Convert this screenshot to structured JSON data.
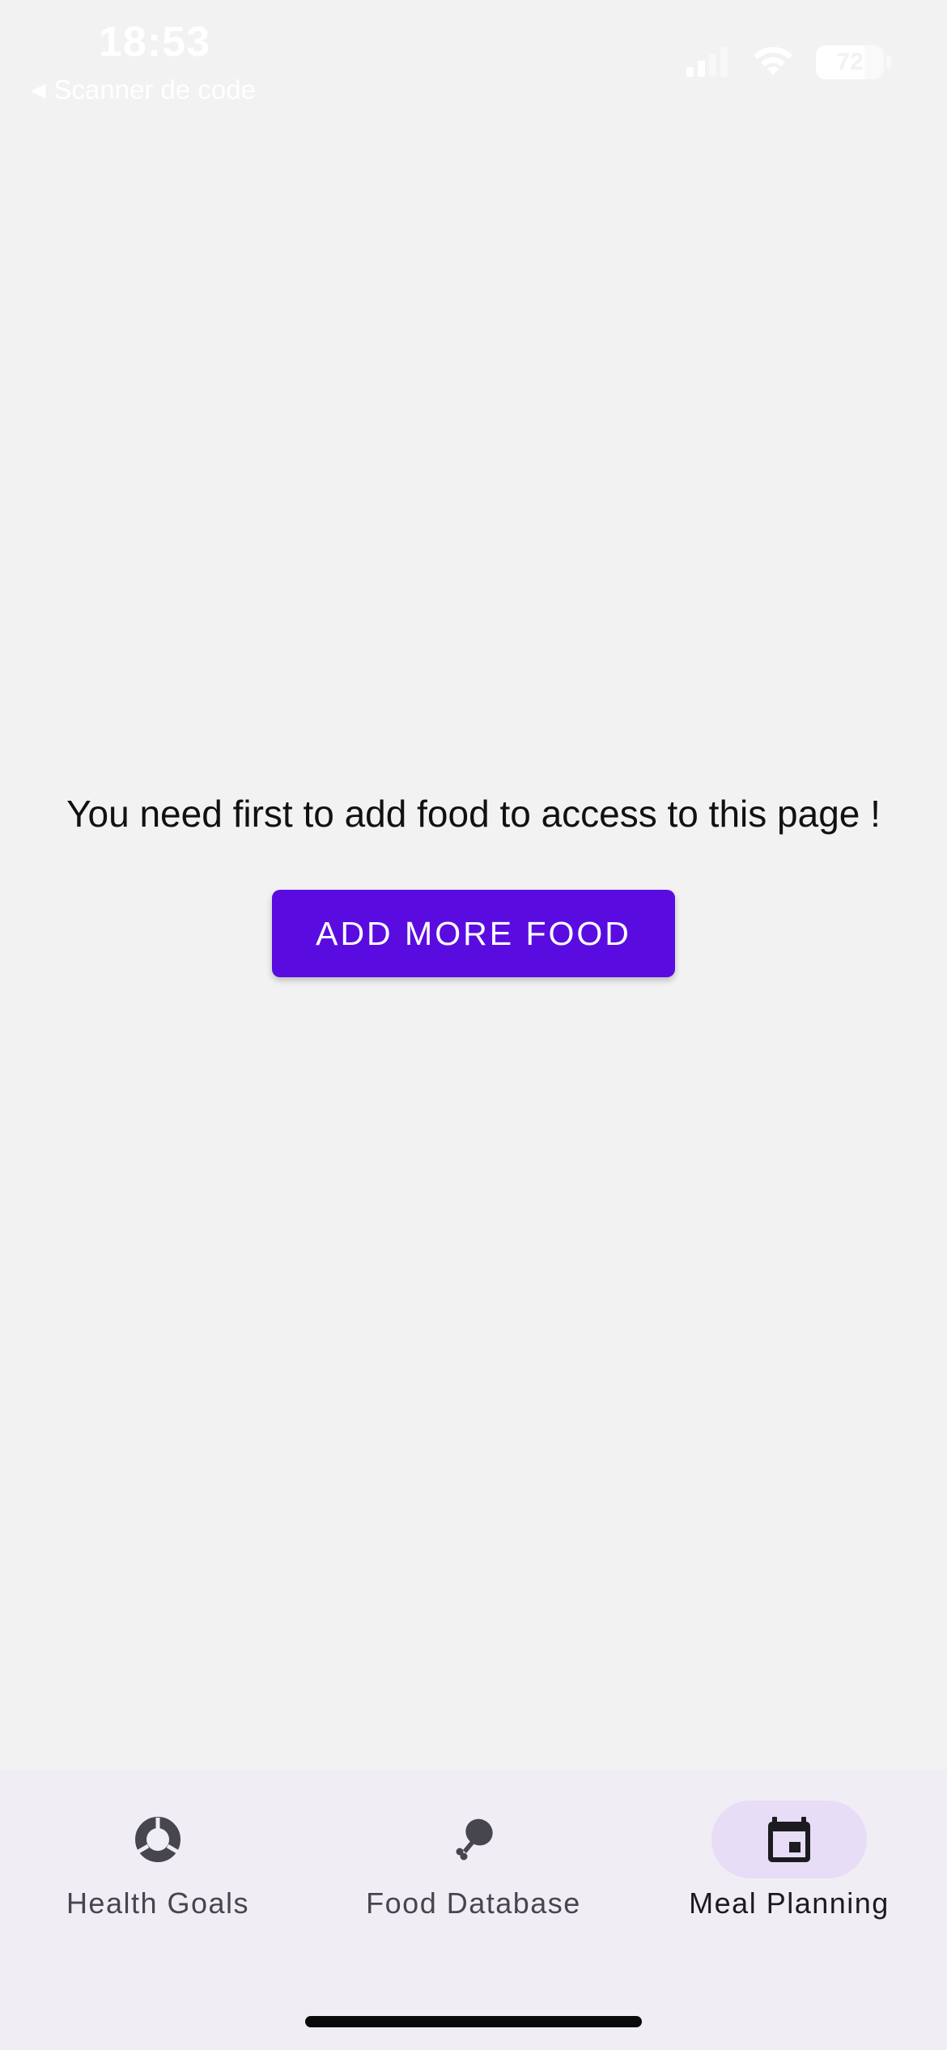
{
  "status_bar": {
    "time": "18:53",
    "back_label": "Scanner de code",
    "battery_level": "72"
  },
  "main": {
    "message": "You need first to add food to access to this page !",
    "button_label": "ADD MORE FOOD"
  },
  "bottom_nav": {
    "items": [
      {
        "label": "Health Goals",
        "icon": "donut-chart-icon",
        "active": false
      },
      {
        "label": "Food Database",
        "icon": "drumstick-icon",
        "active": false
      },
      {
        "label": "Meal Planning",
        "icon": "calendar-icon",
        "active": true
      }
    ]
  },
  "colors": {
    "accent": "#5a0ce0",
    "background": "#f2f2f3",
    "nav_background": "#f1edf5",
    "active_pill": "#e7ddf7"
  }
}
